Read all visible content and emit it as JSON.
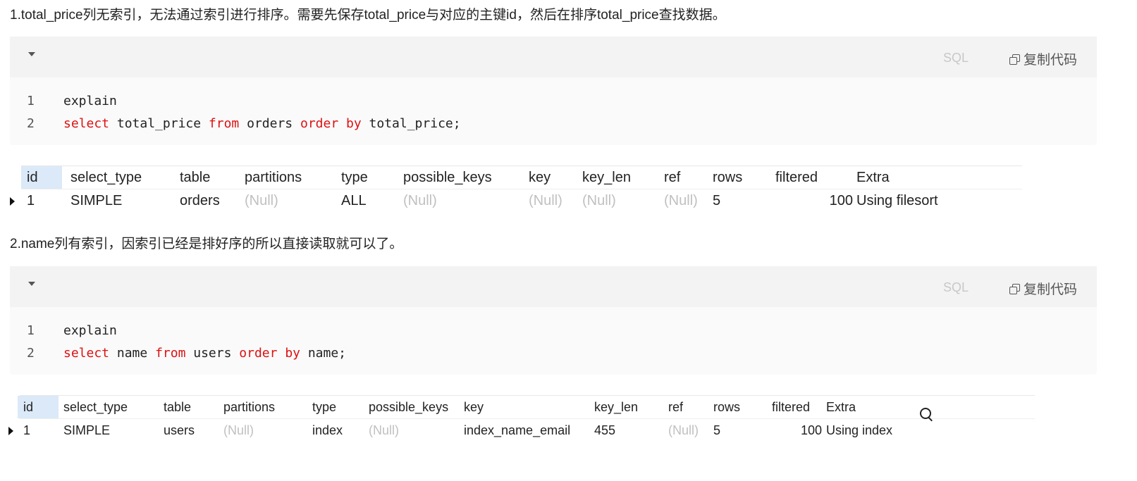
{
  "sections": [
    {
      "heading": "1.total_price列无索引，无法通过索引进行排序。需要先保存total_price与对应的主键id，然后在排序total_price查找数据。",
      "code": {
        "lang": "SQL",
        "copy_label": "复制代码",
        "lines": [
          [
            {
              "t": "explain",
              "k": false
            }
          ],
          [
            {
              "t": "select",
              "k": true
            },
            {
              "t": " total_price ",
              "k": false
            },
            {
              "t": "from",
              "k": true
            },
            {
              "t": " orders ",
              "k": false
            },
            {
              "t": "order",
              "k": true
            },
            {
              "t": " ",
              "k": false
            },
            {
              "t": "by",
              "k": true
            },
            {
              "t": " total_price;",
              "k": false
            }
          ]
        ]
      },
      "table": {
        "columns": [
          "id",
          "select_type",
          "table",
          "partitions",
          "type",
          "possible_keys",
          "key",
          "key_len",
          "ref",
          "rows",
          "filtered",
          "Extra"
        ],
        "rows": [
          [
            "1",
            "SIMPLE",
            "orders",
            "(Null)",
            "ALL",
            "(Null)",
            "(Null)",
            "(Null)",
            "(Null)",
            "5",
            "100",
            "Using filesort"
          ]
        ]
      }
    },
    {
      "heading": "2.name列有索引，因索引已经是排好序的所以直接读取就可以了。",
      "code": {
        "lang": "SQL",
        "copy_label": "复制代码",
        "lines": [
          [
            {
              "t": "explain",
              "k": false
            }
          ],
          [
            {
              "t": "select",
              "k": true
            },
            {
              "t": " name ",
              "k": false
            },
            {
              "t": "from",
              "k": true
            },
            {
              "t": " users ",
              "k": false
            },
            {
              "t": "order",
              "k": true
            },
            {
              "t": " ",
              "k": false
            },
            {
              "t": "by",
              "k": true
            },
            {
              "t": " name;",
              "k": false
            }
          ]
        ]
      },
      "table": {
        "columns": [
          "id",
          "select_type",
          "table",
          "partitions",
          "type",
          "possible_keys",
          "key",
          "key_len",
          "ref",
          "rows",
          "filtered",
          "Extra"
        ],
        "rows": [
          [
            "1",
            "SIMPLE",
            "users",
            "(Null)",
            "index",
            "(Null)",
            "index_name_email",
            "455",
            "(Null)",
            "5",
            "100",
            "Using index"
          ]
        ]
      }
    }
  ]
}
